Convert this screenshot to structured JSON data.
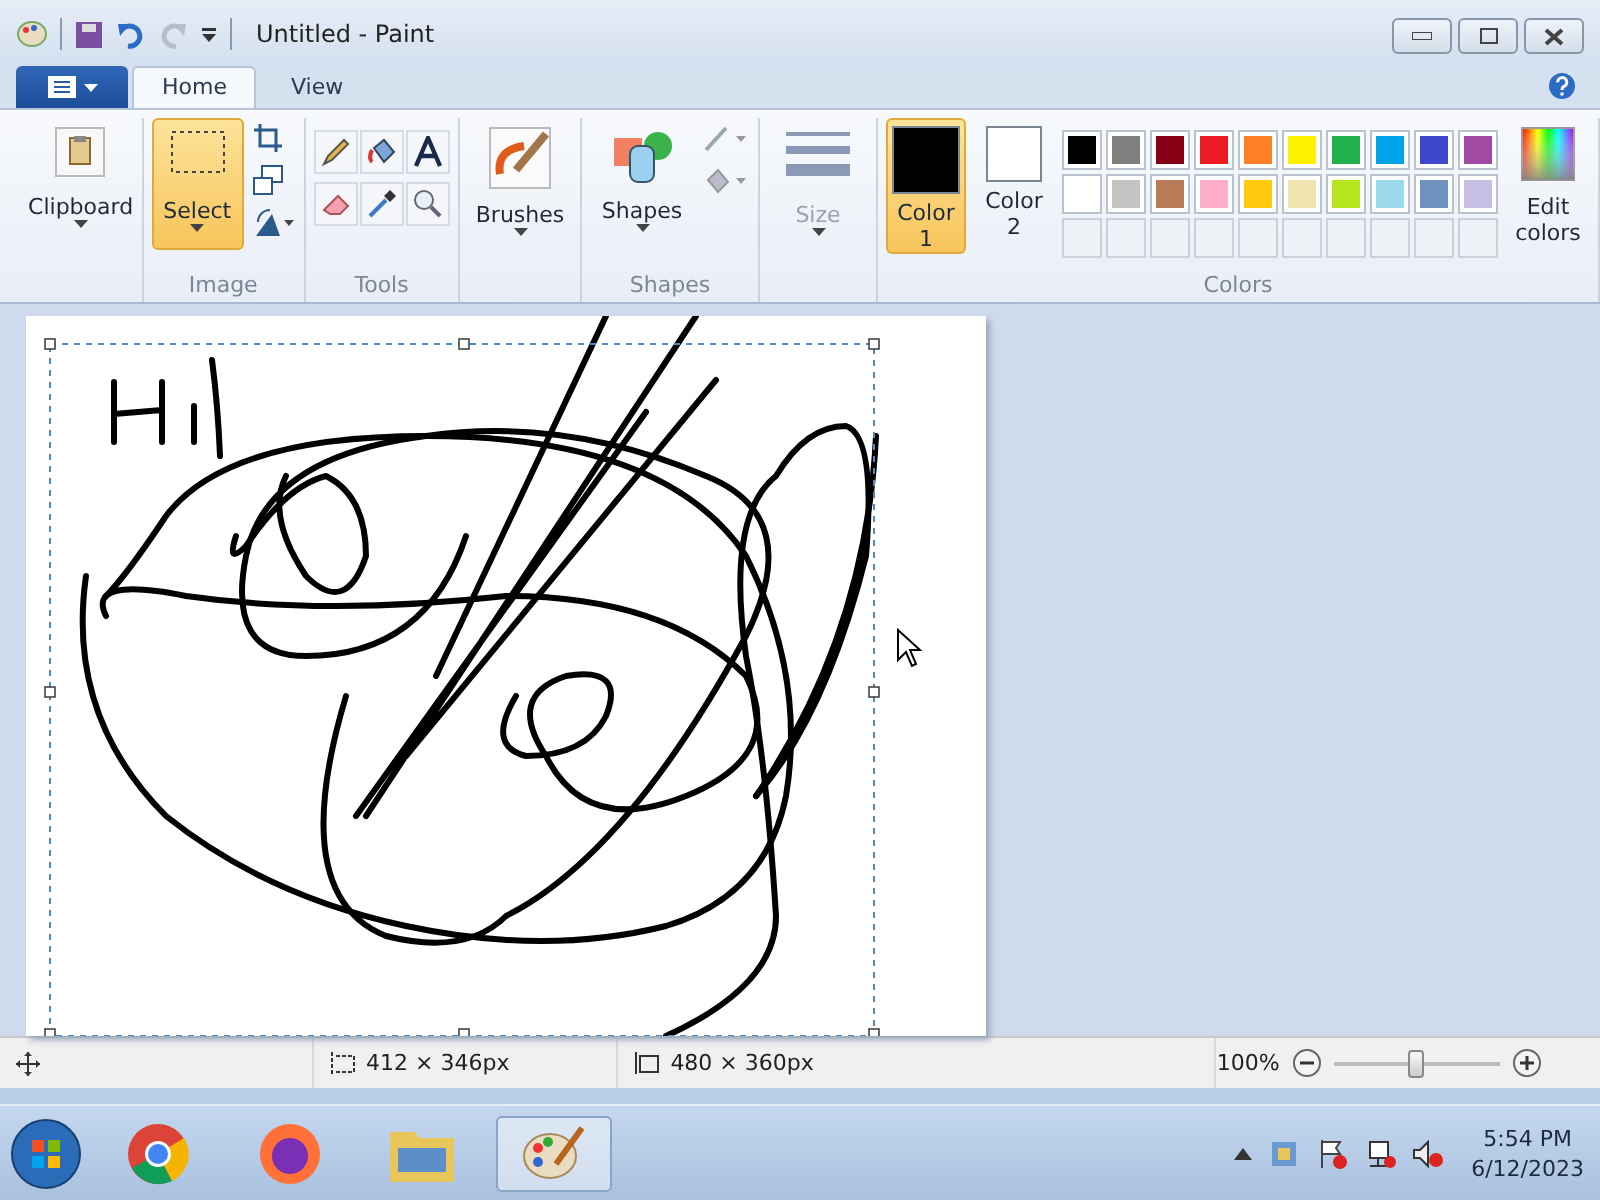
{
  "window": {
    "title": "Untitled - Paint"
  },
  "tabs": [
    {
      "label": "Home",
      "selected": true
    },
    {
      "label": "View",
      "selected": false
    }
  ],
  "ribbon": {
    "clipboard": {
      "label": "Clipboard"
    },
    "image": {
      "select_label": "Select",
      "select_active": true,
      "group_label": "Image"
    },
    "tools": {
      "group_label": "Tools"
    },
    "brushes": {
      "label": "Brushes"
    },
    "shapes": {
      "label": "Shapes",
      "group_label": "Shapes"
    },
    "size": {
      "label": "Size",
      "disabled": true
    },
    "color_slots": [
      {
        "label_line1": "Color",
        "label_line2": "1",
        "color": "#000000",
        "selected": true
      },
      {
        "label_line1": "Color",
        "label_line2": "2",
        "color": "#ffffff",
        "selected": false
      }
    ],
    "palette": [
      {
        "color": "#000000"
      },
      {
        "color": "#7f7f7f"
      },
      {
        "color": "#880015"
      },
      {
        "color": "#ed1c24"
      },
      {
        "color": "#ff7f27"
      },
      {
        "color": "#fff200"
      },
      {
        "color": "#22b14c"
      },
      {
        "color": "#00a2e8"
      },
      {
        "color": "#3f48cc"
      },
      {
        "color": "#a349a4"
      },
      {
        "color": "#ffffff"
      },
      {
        "color": "#c3c3c3"
      },
      {
        "color": "#b97a57"
      },
      {
        "color": "#ffaec9"
      },
      {
        "color": "#ffc90e"
      },
      {
        "color": "#efe4b0"
      },
      {
        "color": "#b5e61d"
      },
      {
        "color": "#99d9ea"
      },
      {
        "color": "#7092be"
      },
      {
        "color": "#c8bfe7"
      }
    ],
    "edit_colors": {
      "line1": "Edit",
      "line2": "colors"
    },
    "colors_group_label": "Colors"
  },
  "status_bar": {
    "selection_size": "412 × 346px",
    "canvas_size": "480 × 360px",
    "zoom": "100%",
    "zoom_level": {
      "level": 0.5
    }
  },
  "taskbar": {
    "apps": [
      {
        "kind": "chrome",
        "selected": false
      },
      {
        "kind": "firefox",
        "selected": false
      },
      {
        "kind": "explorer",
        "selected": false
      },
      {
        "kind": "paint",
        "selected": true
      }
    ],
    "time": "5:54 PM",
    "date": "6/12/2023"
  }
}
